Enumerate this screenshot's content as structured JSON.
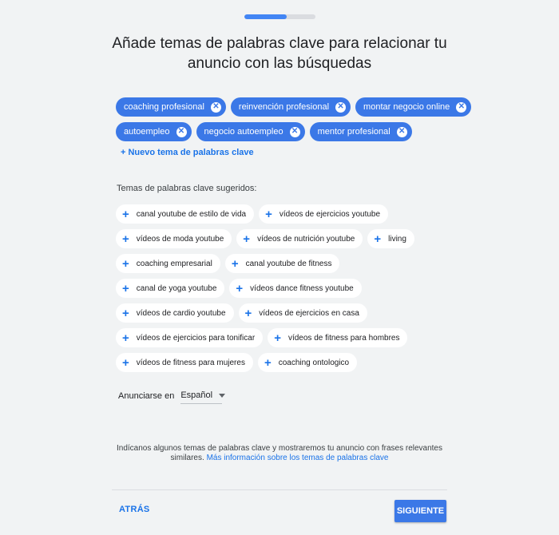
{
  "progress": {
    "percent": 60
  },
  "title": {
    "line1": "Añade temas de palabras clave para relacionar tu",
    "line2": "anuncio con las búsquedas"
  },
  "selected_keywords": [
    [
      "coaching profesional",
      "reinvención profesional",
      "montar negocio online"
    ],
    [
      "autoempleo",
      "negocio autoempleo",
      "mentor profesional"
    ]
  ],
  "add_new_label": "+ Nuevo tema de palabras clave",
  "suggested_label": "Temas de palabras clave sugeridos:",
  "suggested_keywords": [
    [
      "canal youtube de estilo de vida",
      "vídeos de ejercicios youtube"
    ],
    [
      "vídeos de moda youtube",
      "vídeos de nutrición youtube",
      "living"
    ],
    [
      "coaching empresarial",
      "canal youtube de fitness"
    ],
    [
      "canal de yoga youtube",
      "vídeos dance fitness youtube"
    ],
    [
      "vídeos de cardio youtube",
      "vídeos de ejercicios en casa"
    ],
    [
      "vídeos de ejercicios para tonificar",
      "vídeos de fitness para hombres"
    ],
    [
      "vídeos de fitness para mujeres",
      "coaching ontologico"
    ]
  ],
  "language": {
    "label": "Anunciarse en",
    "value": "Español"
  },
  "info": {
    "text": "Indícanos algunos temas de palabras clave y mostraremos tu anuncio con frases relevantes similares.",
    "link": "Más información sobre los temas de palabras clave"
  },
  "buttons": {
    "back": "ATRÁS",
    "next": "SIGUIENTE"
  },
  "icons": {
    "remove": "close-circle-icon",
    "add": "plus-icon",
    "dropdown": "caret-down-icon"
  },
  "colors": {
    "accent": "#3b78e7",
    "link": "#1a73e8",
    "background": "#f1f3f4"
  }
}
